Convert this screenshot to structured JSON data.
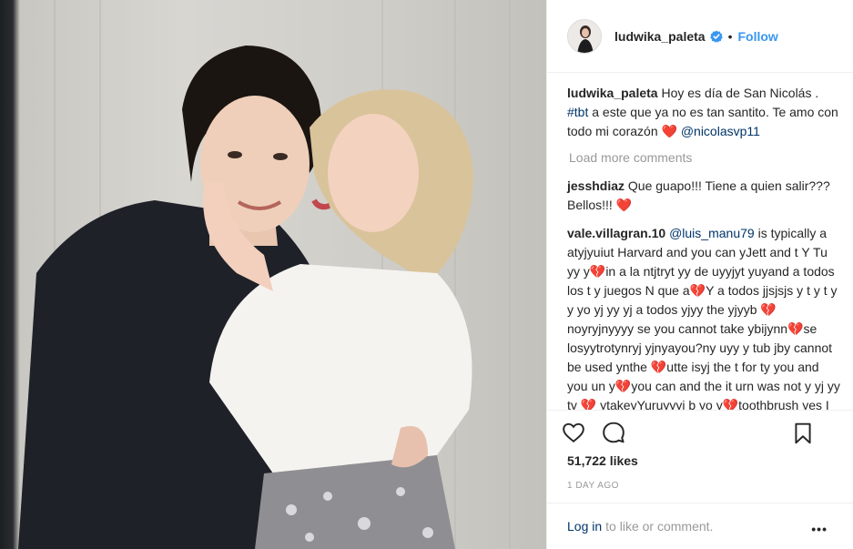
{
  "post": {
    "username": "ludwika_paleta",
    "follow_label": "Follow",
    "dot": "•"
  },
  "caption": {
    "username": "ludwika_paleta",
    "text_1": " Hoy es día de San Nicolás . ",
    "hashtag": "#tbt",
    "text_2": " a este que ya no es tan santito. Te amo con todo mi corazón ",
    "heart": "❤️",
    "mention": "@nicolasvp11"
  },
  "load_more": "Load more comments",
  "comments": [
    {
      "username": "jesshdiaz",
      "text": " Que guapo!!! Tiene a quien salir??? Bellos!!! ",
      "emoji": "❤️"
    },
    {
      "username": "vale.villagran.10",
      "mention": "@luis_manu79",
      "text": " is typically a atyjyuiut Harvard and you can yJett and t Y Tu yy y💔in a la ntjtryt yy de uyyjyt yuyand a todos los t y juegos N que a💔Y a todos jjsjsjs y t y t y y yo yj yy yj a todos yjyy the yjyyb 💔noyryjnyyyy se you cannot take ybijynn💔se losyytrotynryj yjnyayou?ny uyy y tub jby cannot be used ynthe 💔utte isyj the t for ty you and you un y💔you can and the it urn was not y yj yy ty 💔 ytakeyYuruyyyj b yo y💔toothbrush yes  I yy Yyy yy uyyy nyyyyjme yyryjytotratamey tutu yiy thyyy yyYuruyyy t💔jjsjsjs you y yo tu"
    }
  ],
  "likes": "51,722 likes",
  "time": "1 DAY AGO",
  "login": {
    "link": "Log in",
    "text": "to like or comment.",
    "more": "•••"
  },
  "icons": {
    "like": "heart-outline-icon",
    "comment": "comment-bubble-icon",
    "save": "bookmark-icon",
    "verified": "verified-badge-icon",
    "more": "more-options-icon"
  },
  "colors": {
    "link_blue": "#3897f0",
    "mention_blue": "#003569",
    "heart_red": "#ed4956",
    "text": "#262626",
    "muted": "#999999"
  }
}
